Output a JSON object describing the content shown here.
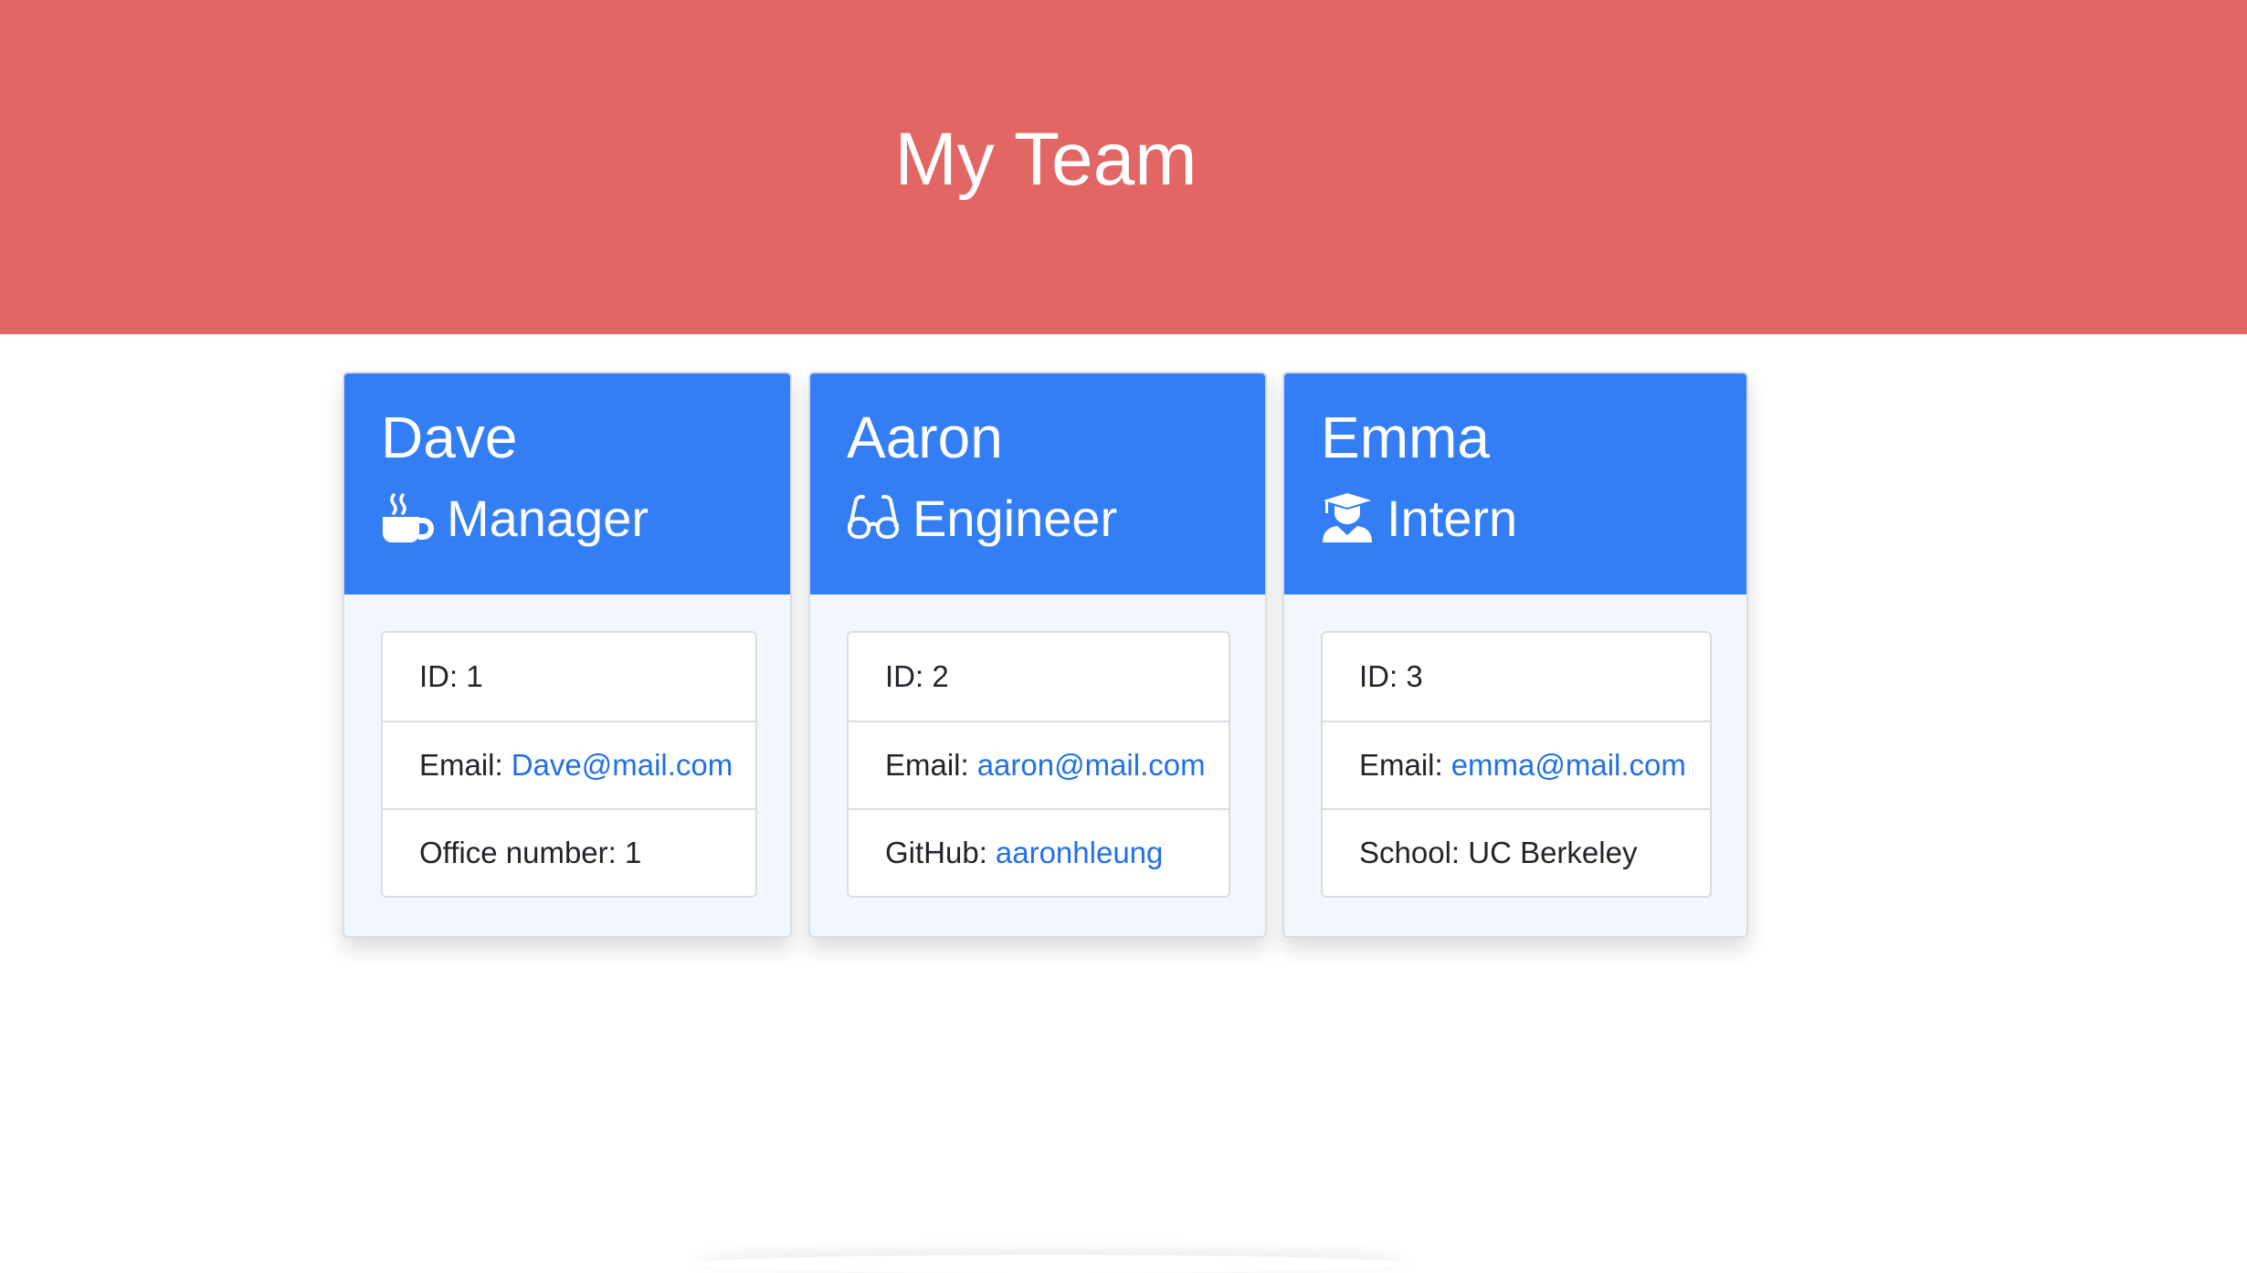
{
  "header": {
    "title": "My Team"
  },
  "accent_colors": {
    "header_bg": "#e26663",
    "card_head_bg": "#347ef5",
    "link": "#2370e6"
  },
  "cards": [
    {
      "name": "Dave",
      "role": "Manager",
      "role_icon": "coffee-mug-icon",
      "id_label": "ID: 1",
      "email_label": "Email:",
      "email": "Dave@mail.com",
      "extra_label": "Office number: 1",
      "extra_link": ""
    },
    {
      "name": "Aaron",
      "role": "Engineer",
      "role_icon": "glasses-icon",
      "id_label": "ID: 2",
      "email_label": "Email:",
      "email": "aaron@mail.com",
      "extra_label": "GitHub:",
      "extra_link": "aaronhleung"
    },
    {
      "name": "Emma",
      "role": "Intern",
      "role_icon": "graduate-student-icon",
      "id_label": "ID: 3",
      "email_label": "Email:",
      "email": "emma@mail.com",
      "extra_label": "School: UC Berkeley",
      "extra_link": ""
    }
  ]
}
